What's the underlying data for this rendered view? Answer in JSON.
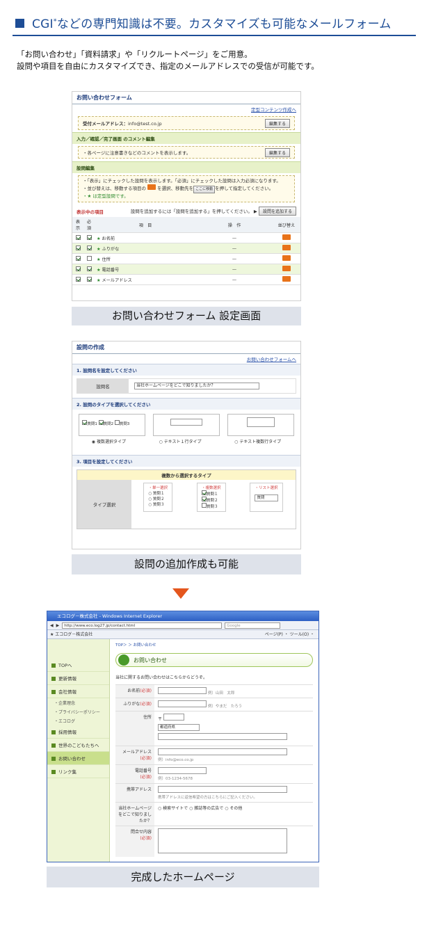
{
  "header": {
    "title_pre": "CGI",
    "title_sup": "*",
    "title_post": "などの専門知識は不要。カスタマイズも可能なメールフォーム"
  },
  "intro": {
    "line1": "「お問い合わせ」「資料請求」や「リクルートページ」をご用意。",
    "line2": "設問や項目を自由にカスタマイズでき、指定のメールアドレスでの受信が可能です。"
  },
  "shot1": {
    "title": "お問い合わせフォーム",
    "link": "定型コンテンツ作成へ",
    "mail_label": "受付メールアドレス：",
    "mail_value": "info@test.co.jp",
    "edit_btn": "編集する",
    "sec_comment": "入力／確認／完了画面 のコメント編集",
    "comment_text": "・各ページに注意書きなどのコメントを表示します。",
    "edit_btn2": "編集する",
    "sec_q": "設問編集",
    "note1": "・「表示」にチェックした設問を表示します。「必須」にチェックした設問は入力必須になります。",
    "note2a": "・並び替えは、移動する項目の",
    "note2b": "を選択、移動先を",
    "note2c": "ここに移動",
    "note2d": "を押して指定してください。",
    "note3": "・★ は定型設問です。",
    "shown": "表示中の項目",
    "add_hint": "設問を追加するには「設問を追加する」を押してください。",
    "add_btn": "設問を追加する",
    "cols": [
      "表示",
      "必須",
      "項　目",
      "操　作",
      "並び替え"
    ],
    "rows": [
      {
        "name": "お名前",
        "op": "—",
        "req": true
      },
      {
        "name": "ふりがな",
        "op": "—",
        "req": true
      },
      {
        "name": "住所",
        "op": "—",
        "req": false
      },
      {
        "name": "電話番号",
        "op": "—",
        "req": true
      },
      {
        "name": "メールアドレス",
        "op": "—",
        "req": true
      }
    ],
    "caption": "お問い合わせフォーム 設定画面"
  },
  "shot2": {
    "title": "設問の作成",
    "link": "お問い合わせフォームへ",
    "step1": "1. 設問名を設定してください",
    "qname_label": "設問名",
    "qname_value": "当社ホームページをどこで知りましたか？",
    "step2": "2. 設問のタイプを選択してください",
    "c1a": "質問1",
    "c1b": "質問2",
    "c1c": "質問3",
    "type1": "複数選択タイプ",
    "type2": "テキスト１行タイプ",
    "type3": "テキスト複数行タイプ",
    "step3": "3. 項目を設定してください",
    "multi_title": "複数から選択するタイプ",
    "type_label": "タイプ選択",
    "opt1": "・単一選択",
    "opt2": "・複数選択",
    "opt3": "・リスト選択",
    "q1": "質問１",
    "q2": "質問２",
    "q3": "質問３",
    "select_val": "質問",
    "caption": "設問の追加作成も可能"
  },
  "shot3": {
    "win_title": "エコログ－株式会社 - Windows Internet Explorer",
    "url": "http://www.eco.log27.jp/contact.html",
    "search": "Google",
    "tab": "エコログ－株式会社",
    "tools": "ページ(P) ・ ツール(O) ・",
    "breadcrumb": "TOP＞ ＞ お問い合わせ",
    "side": [
      {
        "label": "TOPへ",
        "type": "it"
      },
      {
        "label": "更新情報",
        "type": "it"
      },
      {
        "label": "会社情報",
        "type": "it"
      },
      {
        "label": "・企業理念",
        "type": "sub"
      },
      {
        "label": "・プライバシーポリシー",
        "type": "sub"
      },
      {
        "label": "・エコログ",
        "type": "sub"
      },
      {
        "label": "採用情報",
        "type": "it"
      },
      {
        "label": "世界のこどもたちへ",
        "type": "it"
      },
      {
        "label": "お問い合わせ",
        "type": "it act"
      },
      {
        "label": "リンク集",
        "type": "it"
      }
    ],
    "page_title": "お問い合わせ",
    "lead": "当社に関するお問い合わせはこちらからどうぞ。",
    "f_name": "お名前",
    "req": "(必須)",
    "f_name_ex": "例）山田　太郎",
    "f_kana": "ふりがな",
    "f_kana_ex": "例）やまだ　たろう",
    "f_addr": "住所",
    "zip_mark": "〒",
    "pref": "都道府県",
    "f_mail": "メールアドレス",
    "f_mail_ex": "例）info@eco.co.jp",
    "f_tel": "電話番号",
    "f_tel_ex": "例）03-1234-5678",
    "f_mobile": "携帯アドレス",
    "f_mobile_ex": "携帯アドレスに返信希望の方はこちらにご記入ください。",
    "f_where": "当社ホームページをどこで知りましたか？",
    "w1": "検索サイトで",
    "w2": "雑誌等の広告で",
    "w3": "その他",
    "f_body": "問合せ内容",
    "caption": "完成したホームページ"
  },
  "colors": {
    "accent": "#1d4d96",
    "arrow": "#e4561d",
    "caption_bg": "#dee2ea",
    "section_green": "#e7f1c9"
  }
}
